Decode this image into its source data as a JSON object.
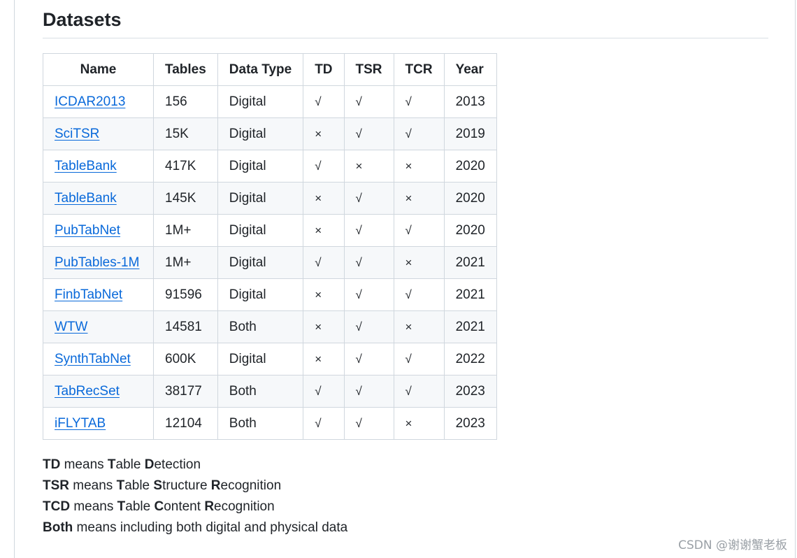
{
  "heading": "Datasets",
  "table": {
    "headers": [
      "Name",
      "Tables",
      "Data Type",
      "TD",
      "TSR",
      "TCR",
      "Year"
    ],
    "rows": [
      {
        "name": "ICDAR2013",
        "tables": "156",
        "type": "Digital",
        "td": "√",
        "tsr": "√",
        "tcr": "√",
        "year": "2013"
      },
      {
        "name": "SciTSR",
        "tables": "15K",
        "type": "Digital",
        "td": "×",
        "tsr": "√",
        "tcr": "√",
        "year": "2019"
      },
      {
        "name": "TableBank",
        "tables": "417K",
        "type": "Digital",
        "td": "√",
        "tsr": "×",
        "tcr": "×",
        "year": "2020"
      },
      {
        "name": "TableBank",
        "tables": "145K",
        "type": "Digital",
        "td": "×",
        "tsr": "√",
        "tcr": "×",
        "year": "2020"
      },
      {
        "name": "PubTabNet",
        "tables": "1M+",
        "type": "Digital",
        "td": "×",
        "tsr": "√",
        "tcr": "√",
        "year": "2020"
      },
      {
        "name": "PubTables-1M",
        "tables": "1M+",
        "type": "Digital",
        "td": "√",
        "tsr": "√",
        "tcr": "×",
        "year": "2021"
      },
      {
        "name": "FinbTabNet",
        "tables": "91596",
        "type": "Digital",
        "td": "×",
        "tsr": "√",
        "tcr": "√",
        "year": "2021"
      },
      {
        "name": "WTW",
        "tables": "14581",
        "type": "Both",
        "td": "×",
        "tsr": "√",
        "tcr": "×",
        "year": "2021"
      },
      {
        "name": "SynthTabNet",
        "tables": "600K",
        "type": "Digital",
        "td": "×",
        "tsr": "√",
        "tcr": "√",
        "year": "2022"
      },
      {
        "name": "TabRecSet",
        "tables": "38177",
        "type": "Both",
        "td": "√",
        "tsr": "√",
        "tcr": "√",
        "year": "2023"
      },
      {
        "name": "iFLYTAB",
        "tables": "12104",
        "type": "Both",
        "td": "√",
        "tsr": "√",
        "tcr": "×",
        "year": "2023"
      }
    ]
  },
  "notes": [
    {
      "parts": [
        {
          "b": "TD"
        },
        {
          "t": " means "
        },
        {
          "b": "T"
        },
        {
          "t": "able "
        },
        {
          "b": "D"
        },
        {
          "t": "etection"
        }
      ]
    },
    {
      "parts": [
        {
          "b": "TSR"
        },
        {
          "t": " means "
        },
        {
          "b": "T"
        },
        {
          "t": "able "
        },
        {
          "b": "S"
        },
        {
          "t": "tructure "
        },
        {
          "b": "R"
        },
        {
          "t": "ecognition"
        }
      ]
    },
    {
      "parts": [
        {
          "b": "TCD"
        },
        {
          "t": " means "
        },
        {
          "b": "T"
        },
        {
          "t": "able "
        },
        {
          "b": "C"
        },
        {
          "t": "ontent "
        },
        {
          "b": "R"
        },
        {
          "t": "ecognition"
        }
      ]
    },
    {
      "parts": [
        {
          "b": "Both"
        },
        {
          "t": " means including both digital and physical data"
        }
      ]
    }
  ],
  "watermark": "CSDN @谢谢蟹老板"
}
